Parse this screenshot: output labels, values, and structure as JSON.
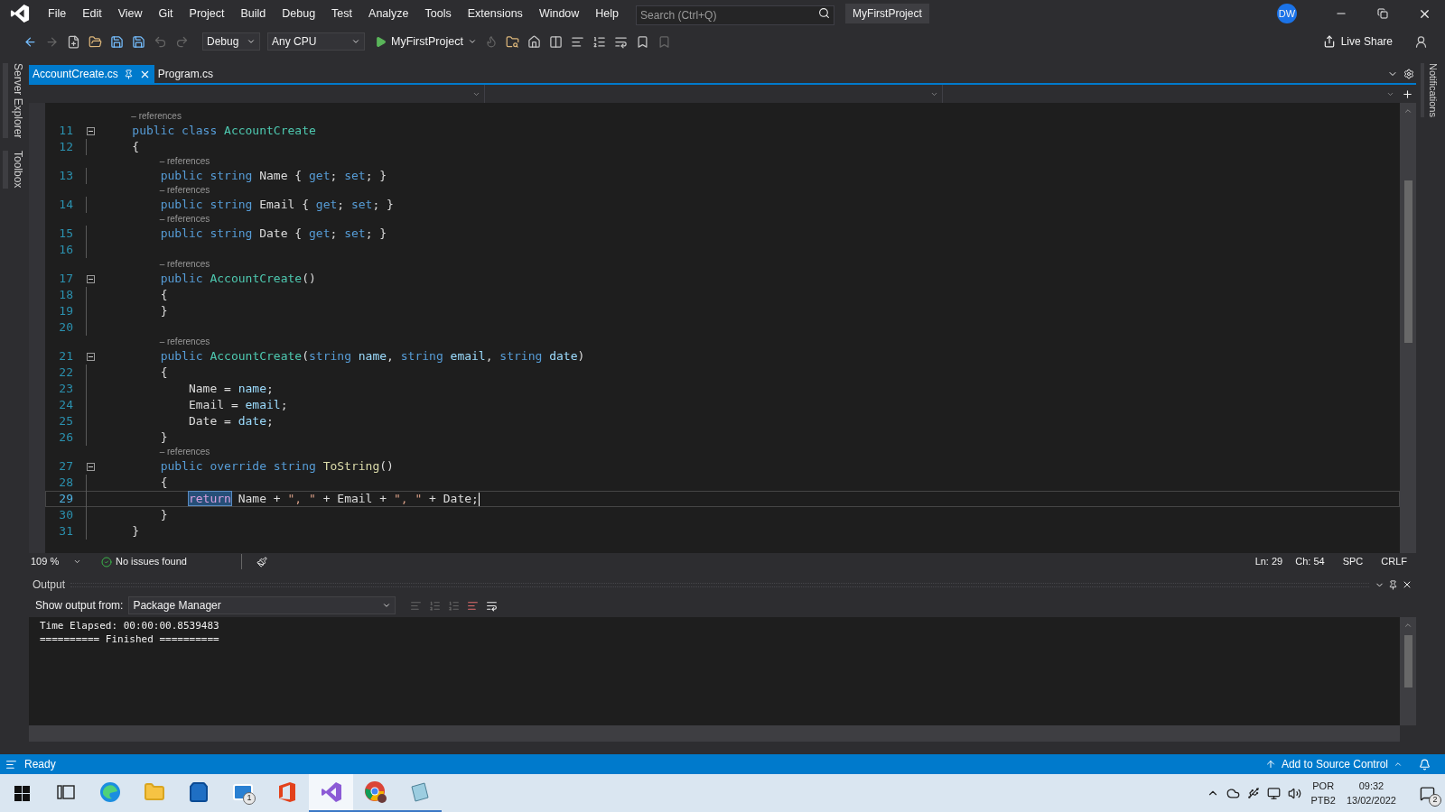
{
  "title_bar": {
    "menu": [
      "File",
      "Edit",
      "View",
      "Git",
      "Project",
      "Build",
      "Debug",
      "Test",
      "Analyze",
      "Tools",
      "Extensions",
      "Window",
      "Help"
    ],
    "search": {
      "placeholder": "Search (Ctrl+Q)"
    },
    "solution_name": "MyFirstProject",
    "avatar": "DW"
  },
  "toolbar": {
    "configuration": "Debug",
    "platform": "Any CPU",
    "start_target": "MyFirstProject",
    "live_share": "Live Share"
  },
  "side_tabs_left": [
    "Server Explorer",
    "Toolbox"
  ],
  "side_tabs_right": [
    "Notifications"
  ],
  "editor_tabs": [
    {
      "label": "AccountCreate.cs",
      "selected": true
    },
    {
      "label": "Program.cs",
      "selected": false
    }
  ],
  "code_lines": [
    {
      "number": "11",
      "codelens": "– references",
      "fold": true,
      "current": false,
      "tokens": [
        {
          "kind": "keyword",
          "text": "    public class "
        },
        {
          "kind": "type",
          "text": "AccountCreate"
        }
      ]
    },
    {
      "number": "12",
      "fold": false,
      "current": false,
      "tokens": [
        {
          "kind": "plain",
          "text": "    {"
        }
      ]
    },
    {
      "number": "13",
      "codelens": "– references",
      "fold": false,
      "current": false,
      "tokens": [
        {
          "kind": "keyword",
          "text": "        public string "
        },
        {
          "kind": "plain",
          "text": "Name { "
        },
        {
          "kind": "keyword",
          "text": "get"
        },
        {
          "kind": "plain",
          "text": "; "
        },
        {
          "kind": "keyword",
          "text": "set"
        },
        {
          "kind": "plain",
          "text": "; }"
        }
      ]
    },
    {
      "number": "14",
      "codelens": "– references",
      "fold": false,
      "current": false,
      "tokens": [
        {
          "kind": "keyword",
          "text": "        public string "
        },
        {
          "kind": "plain",
          "text": "Email { "
        },
        {
          "kind": "keyword",
          "text": "get"
        },
        {
          "kind": "plain",
          "text": "; "
        },
        {
          "kind": "keyword",
          "text": "set"
        },
        {
          "kind": "plain",
          "text": "; }"
        }
      ]
    },
    {
      "number": "15",
      "codelens": "– references",
      "fold": false,
      "current": false,
      "tokens": [
        {
          "kind": "keyword",
          "text": "        public string "
        },
        {
          "kind": "plain",
          "text": "Date { "
        },
        {
          "kind": "keyword",
          "text": "get"
        },
        {
          "kind": "plain",
          "text": "; "
        },
        {
          "kind": "keyword",
          "text": "set"
        },
        {
          "kind": "plain",
          "text": "; }"
        }
      ]
    },
    {
      "number": "16",
      "fold": false,
      "current": false
    },
    {
      "number": "17",
      "codelens": "– references",
      "fold": true,
      "current": false,
      "tokens": [
        {
          "kind": "keyword",
          "text": "        public "
        },
        {
          "kind": "type",
          "text": "AccountCreate"
        },
        {
          "kind": "plain",
          "text": "()"
        }
      ]
    },
    {
      "number": "18",
      "fold": false,
      "current": false,
      "tokens": [
        {
          "kind": "plain",
          "text": "        {"
        }
      ]
    },
    {
      "number": "19",
      "fold": false,
      "current": false,
      "tokens": [
        {
          "kind": "plain",
          "text": "        }"
        }
      ]
    },
    {
      "number": "20",
      "fold": false,
      "current": false
    },
    {
      "number": "21",
      "codelens": "– references",
      "fold": true,
      "current": false,
      "tokens": [
        {
          "kind": "keyword",
          "text": "        public "
        },
        {
          "kind": "type",
          "text": "AccountCreate"
        },
        {
          "kind": "plain",
          "text": "("
        },
        {
          "kind": "keyword",
          "text": "string "
        },
        {
          "kind": "parameter",
          "text": "name"
        },
        {
          "kind": "plain",
          "text": ", "
        },
        {
          "kind": "keyword",
          "text": "string "
        },
        {
          "kind": "parameter",
          "text": "email"
        },
        {
          "kind": "plain",
          "text": ", "
        },
        {
          "kind": "keyword",
          "text": "string "
        },
        {
          "kind": "parameter",
          "text": "date"
        },
        {
          "kind": "plain",
          "text": ")"
        }
      ]
    },
    {
      "number": "22",
      "fold": false,
      "current": false,
      "tokens": [
        {
          "kind": "plain",
          "text": "        {"
        }
      ]
    },
    {
      "number": "23",
      "fold": false,
      "current": false,
      "tokens": [
        {
          "kind": "plain",
          "text": "            Name = "
        },
        {
          "kind": "parameter",
          "text": "name"
        },
        {
          "kind": "plain",
          "text": ";"
        }
      ]
    },
    {
      "number": "24",
      "fold": false,
      "current": false,
      "tokens": [
        {
          "kind": "plain",
          "text": "            Email = "
        },
        {
          "kind": "parameter",
          "text": "email"
        },
        {
          "kind": "plain",
          "text": ";"
        }
      ]
    },
    {
      "number": "25",
      "fold": false,
      "current": false,
      "tokens": [
        {
          "kind": "plain",
          "text": "            Date = "
        },
        {
          "kind": "parameter",
          "text": "date"
        },
        {
          "kind": "plain",
          "text": ";"
        }
      ]
    },
    {
      "number": "26",
      "fold": false,
      "current": false,
      "tokens": [
        {
          "kind": "plain",
          "text": "        }"
        }
      ]
    },
    {
      "number": "27",
      "codelens": "– references",
      "fold": true,
      "current": false,
      "tokens": [
        {
          "kind": "keyword",
          "text": "        public override string "
        },
        {
          "kind": "method",
          "text": "ToString"
        },
        {
          "kind": "plain",
          "text": "()"
        }
      ]
    },
    {
      "number": "28",
      "fold": false,
      "current": false,
      "tokens": [
        {
          "kind": "plain",
          "text": "        {"
        }
      ]
    },
    {
      "number": "29",
      "fold": false,
      "current": true,
      "tokens": [
        {
          "kind": "control-selected",
          "text": "            return"
        },
        {
          "kind": "plain",
          "text": " Name + "
        },
        {
          "kind": "string",
          "text": "\", \""
        },
        {
          "kind": "plain",
          "text": " + Email + "
        },
        {
          "kind": "string",
          "text": "\", \""
        },
        {
          "kind": "plain",
          "text": " + Date;"
        }
      ]
    },
    {
      "number": "30",
      "fold": false,
      "current": false,
      "tokens": [
        {
          "kind": "plain",
          "text": "        }"
        }
      ]
    },
    {
      "number": "31",
      "fold": false,
      "current": false,
      "tokens": [
        {
          "kind": "plain",
          "text": "    }"
        }
      ]
    }
  ],
  "editor_status": {
    "zoom": "109 %",
    "issues": "No issues found",
    "line": "Ln: 29",
    "column": "Ch: 54",
    "whitespace": "SPC",
    "line_ending": "CRLF"
  },
  "output": {
    "title": "Output",
    "source_label": "Show output from:",
    "source": "Package Manager",
    "lines": [
      "Time Elapsed: 00:00:00.8539483",
      "========== Finished =========="
    ]
  },
  "status_bar": {
    "text": "Ready",
    "source_control": "Add to Source Control"
  },
  "taskbar": {
    "apps": [
      {
        "kind": "taskview",
        "running": false,
        "active": false
      },
      {
        "kind": "edge",
        "running": false,
        "active": false
      },
      {
        "kind": "explorer",
        "running": false,
        "active": false
      },
      {
        "kind": "store",
        "running": false,
        "active": false
      },
      {
        "kind": "mail",
        "running": false,
        "active": false,
        "badge": "1"
      },
      {
        "kind": "office",
        "running": false,
        "active": false
      },
      {
        "kind": "visualstudio",
        "running": true,
        "active": true
      },
      {
        "kind": "chrome",
        "running": true,
        "active": false
      },
      {
        "kind": "notes",
        "running": true,
        "active": false
      }
    ],
    "language": "POR",
    "layout": "PTB2",
    "time": "09:32",
    "date": "13/02/2022",
    "notifications": "2"
  }
}
